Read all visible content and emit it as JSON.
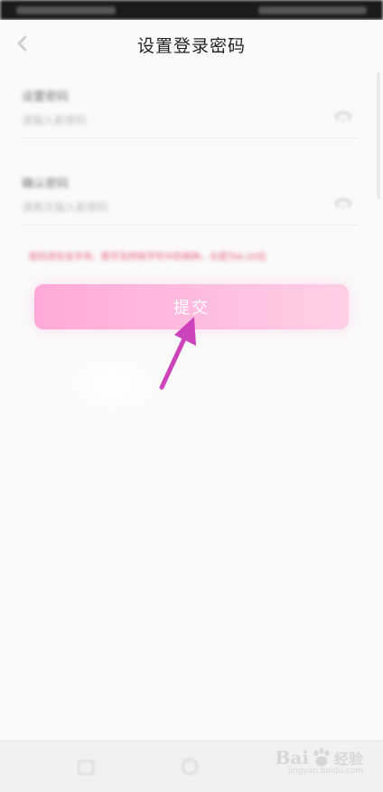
{
  "header": {
    "title": "设置登录密码",
    "back_icon": "chevron-left-icon"
  },
  "form": {
    "fields": [
      {
        "label": "设置密码",
        "placeholder": "请输入新密码",
        "toggle_icon": "eye-icon"
      },
      {
        "label": "确认密码",
        "placeholder": "请再次输入新密码",
        "toggle_icon": "eye-icon"
      }
    ],
    "hint": "密码须包含字母、数字及特殊字符中的两种，长度为8-20位"
  },
  "submit": {
    "label": "提交",
    "color": "#ffb3dd"
  },
  "annotation": {
    "arrow_color": "#cc44bb"
  },
  "watermark": {
    "brand_a": "Bai",
    "brand_b": "经验",
    "url": "jingyan.baidu.com"
  },
  "colors": {
    "hint": "#e8607a",
    "background": "#fafafa"
  }
}
